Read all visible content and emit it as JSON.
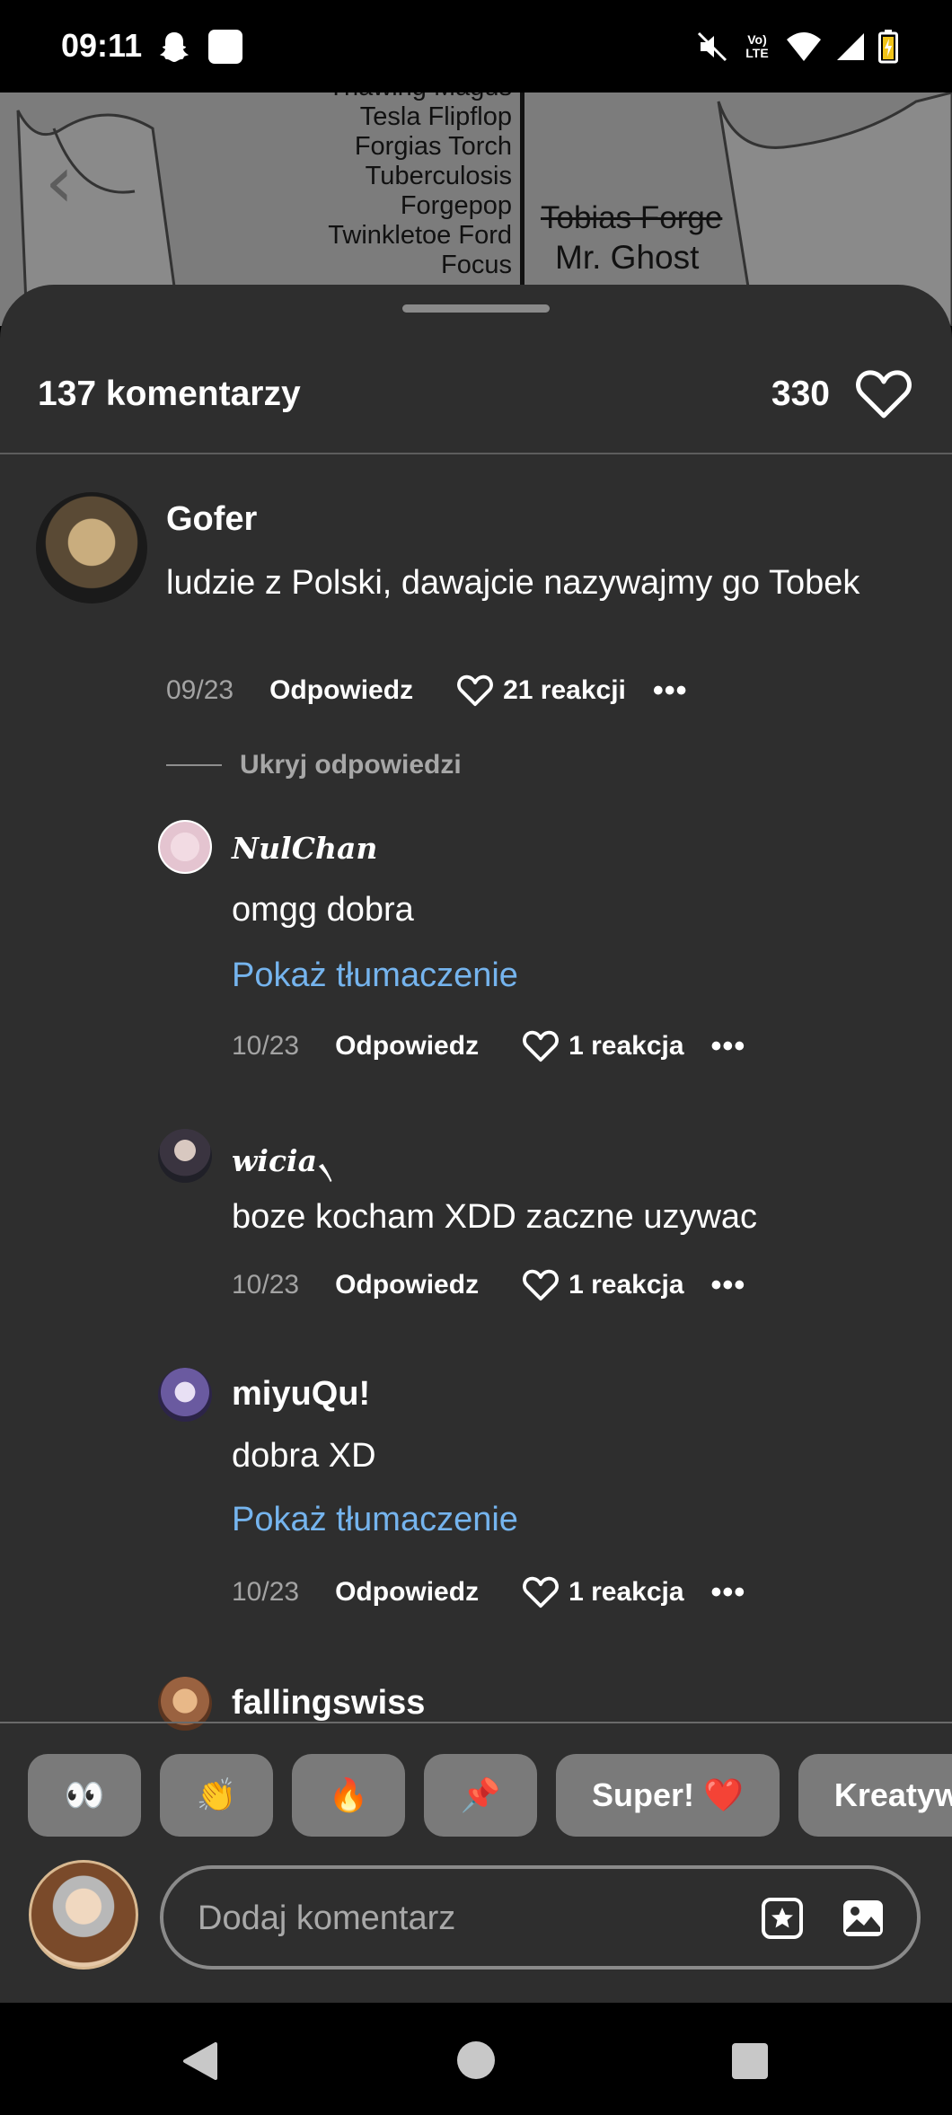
{
  "status_bar": {
    "time": "09:11",
    "network": "LTE"
  },
  "background_pin": {
    "names_list": [
      "Thawing Magus",
      "Tesla Flipflop",
      "Forgias Torch",
      "Tuberculosis",
      "Forgepop",
      "Twinkletoe Ford",
      "Focus"
    ],
    "struck_name": "Tobias Forge",
    "ghost_name": "Mr. Ghost"
  },
  "header": {
    "comment_count": "137 komentarzy",
    "like_count": "330"
  },
  "top_comment": {
    "username": "Gofer",
    "text": "ludzie z Polski, dawajcie nazywajmy go Tobek",
    "date": "09/23",
    "reply_label": "Odpowiedz",
    "reactions": "21 reakcji",
    "more": "•••"
  },
  "hide_replies_label": "Ukryj odpowiedzi",
  "replies": [
    {
      "username": "NulChan",
      "text": "omgg dobra",
      "translate": "Pokaż tłumaczenie",
      "date": "10/23",
      "reply_label": "Odpowiedz",
      "reactions": "1 reakcja",
      "more": "•••"
    },
    {
      "username": "wicia৲",
      "text": "boze kocham XDD zaczne uzywac",
      "date": "10/23",
      "reply_label": "Odpowiedz",
      "reactions": "1 reakcja",
      "more": "•••"
    },
    {
      "username": "miyuQu!",
      "text": "dobra XD",
      "translate": "Pokaż tłumaczenie",
      "date": "10/23",
      "reply_label": "Odpowiedz",
      "reactions": "1 reakcja",
      "more": "•••"
    },
    {
      "username": "fallingswiss"
    }
  ],
  "quick_reactions": [
    "👀",
    "👏",
    "🔥",
    "📌",
    "Super! ❤️",
    "Kreatywne"
  ],
  "composer": {
    "placeholder": "Dodaj komentarz"
  },
  "icons": {
    "heart": "heart-icon",
    "sticker": "sticker-icon",
    "image": "image-icon",
    "back": "chevron-left-icon"
  },
  "colors": {
    "sheet": "#2e2e2e",
    "link": "#75b4ee",
    "chip": "#7a7a7a"
  }
}
